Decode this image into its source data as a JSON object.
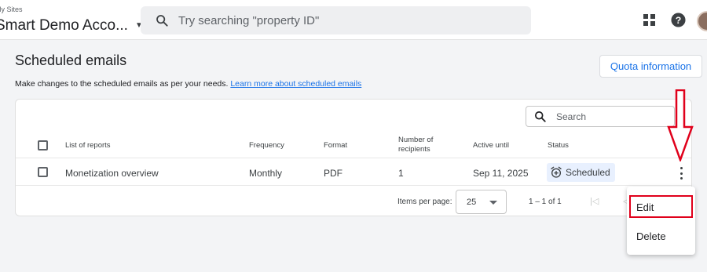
{
  "header": {
    "account_sub": "My Sites",
    "account_name": "Smart Demo Acco...",
    "search_placeholder": "Try searching \"property ID\""
  },
  "page": {
    "title": "Scheduled emails",
    "quota_button": "Quota information",
    "description": "Make changes to the scheduled emails as per your needs.",
    "learn_more": "Learn more about scheduled emails"
  },
  "table": {
    "search_placeholder": "Search",
    "columns": {
      "reports": "List of reports",
      "frequency": "Frequency",
      "format": "Format",
      "recipients_line1": "Number of",
      "recipients_line2": "recipients",
      "active_until": "Active until",
      "status": "Status"
    },
    "rows": [
      {
        "report": "Monetization overview",
        "frequency": "Monthly",
        "format": "PDF",
        "recipients": "1",
        "active_until": "Sep 11, 2025",
        "status": "Scheduled"
      }
    ],
    "pagination": {
      "items_per_page_label": "Items per page:",
      "items_per_page_value": "25",
      "range": "1 – 1 of 1"
    }
  },
  "menu": {
    "items": [
      "Edit",
      "Delete"
    ]
  },
  "colors": {
    "accent": "#1a73e8",
    "annotation": "#e0001b",
    "status_badge_bg": "#e8f0fe"
  },
  "icons": [
    "search-icon",
    "apps-grid-icon",
    "help-icon",
    "alarm-add-icon",
    "more-vert-icon",
    "first-page-icon",
    "prev-page-icon"
  ]
}
